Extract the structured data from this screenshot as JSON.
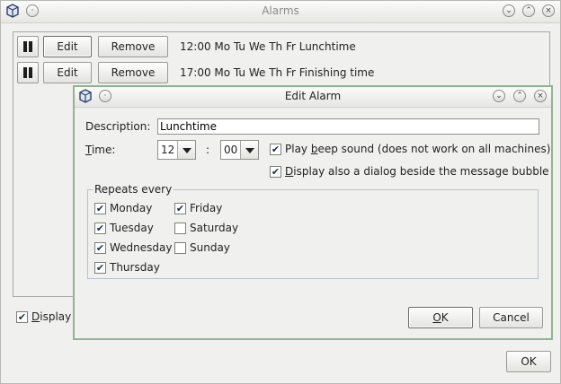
{
  "main_window": {
    "title": "Alarms",
    "alarms": [
      {
        "edit_label": "Edit",
        "remove_label": "Remove",
        "summary": "12:00 Mo Tu We Th Fr  Lunchtime"
      },
      {
        "edit_label": "Edit",
        "remove_label": "Remove",
        "summary": "17:00 Mo Tu We Th Fr  Finishing time"
      }
    ],
    "display_checkbox_label": "Display",
    "display_checked": true,
    "ok_label": "OK"
  },
  "dialog": {
    "title": "Edit Alarm",
    "description_label": "Description:",
    "description_value": "Lunchtime",
    "time_label": "Time:",
    "hour_value": "12",
    "separator": ":",
    "minute_value": "00",
    "play_beep_label": "Play beep sound (does not work on all machines)",
    "play_beep_checked": true,
    "display_dialog_label": "Display also a dialog beside the message bubble",
    "display_dialog_checked": true,
    "repeats_label": "Repeats every",
    "days": [
      {
        "label": "Monday",
        "checked": true
      },
      {
        "label": "Tuesday",
        "checked": true
      },
      {
        "label": "Wednesday",
        "checked": true
      },
      {
        "label": "Thursday",
        "checked": true
      },
      {
        "label": "Friday",
        "checked": true
      },
      {
        "label": "Saturday",
        "checked": false
      },
      {
        "label": "Sunday",
        "checked": false
      }
    ],
    "ok_label": "OK",
    "cancel_label": "Cancel"
  },
  "icons": [
    "app-icon",
    "menu-icon",
    "minimize-icon",
    "maximize-icon",
    "close-icon",
    "pause-icon",
    "checkmark-icon",
    "dropdown-arrow-icon"
  ],
  "colors": {
    "window_bg": "#f0f0ee",
    "dialog_border": "#8fb58f",
    "check_color": "#1a2b50"
  }
}
